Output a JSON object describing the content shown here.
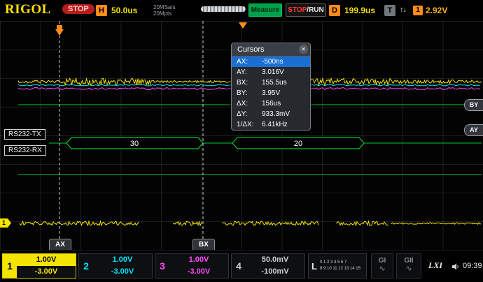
{
  "top_bar": {
    "logo": "RIGOL",
    "run_state": "STOP",
    "h_label": "H",
    "timebase": "50.0us",
    "sample_rate": "20MSa/s",
    "memory_depth": "20Mpts",
    "measure_label": "Measure",
    "stop_run_label_stop": "STOP",
    "stop_run_label_run": "/RUN",
    "d_label": "D",
    "delay": "199.9us",
    "t_label": "T",
    "trigger_arrows": "↑↓",
    "trigger_source": "1",
    "trigger_level": "2.92V"
  },
  "cursors_panel": {
    "title": "Cursors",
    "close_icon": "✕",
    "rows": [
      {
        "label": "AX:",
        "value": "-500ns"
      },
      {
        "label": "AY:",
        "value": "3.016V"
      },
      {
        "label": "BX:",
        "value": "155.5us"
      },
      {
        "label": "BY:",
        "value": "3.95V"
      },
      {
        "label": "ΔX:",
        "value": "156us"
      },
      {
        "label": "ΔY:",
        "value": "933.3mV"
      },
      {
        "label": "1/ΔX:",
        "value": "6.41kHz"
      }
    ]
  },
  "scope": {
    "decode_labels": {
      "tx": "RS232-TX",
      "rx": "RS232-RX"
    },
    "bus_values": [
      "30",
      "20"
    ],
    "cursor_tags": {
      "ax": "AX",
      "bx": "BX",
      "ay": "AY",
      "by": "BY"
    },
    "ch1_marker": "1"
  },
  "bottom_bar": {
    "channels": [
      {
        "num": "1",
        "scale": "1.00V",
        "offset": "-3.00V"
      },
      {
        "num": "2",
        "scale": "1.00V",
        "offset": "-3.00V"
      },
      {
        "num": "3",
        "scale": "1.00V",
        "offset": "-3.00V"
      },
      {
        "num": "4",
        "scale": "50.0mV",
        "offset": "-100mV"
      }
    ],
    "digital": {
      "label": "L",
      "row1": "0 1 2 3 4 5 6 7",
      "row2": "8 9 10 11 12 13 14 15"
    },
    "g1_label": "GI",
    "g2_label": "GII",
    "wave_icon": "∿",
    "lxi_label": "LXI",
    "time": "09:39"
  },
  "colors": {
    "ch1": "#f5e400",
    "ch2": "#00e5ff",
    "ch3": "#ff4dff",
    "ch4": "#c9ced3",
    "decode_green": "#00c832",
    "trigger_orange": "#ff8c1a",
    "cursor_line": "#c8c8c8",
    "selected_row_blue": "#1a6fd4"
  }
}
